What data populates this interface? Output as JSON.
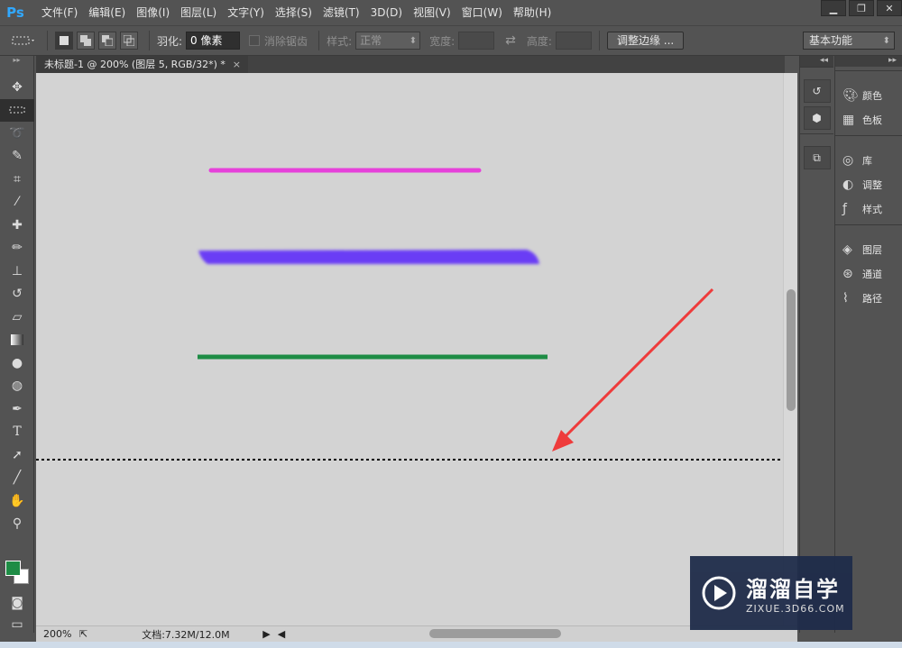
{
  "app": {
    "logo": "Ps",
    "menus": [
      "文件(F)",
      "编辑(E)",
      "图像(I)",
      "图层(L)",
      "文字(Y)",
      "选择(S)",
      "滤镜(T)",
      "3D(D)",
      "视图(V)",
      "窗口(W)",
      "帮助(H)"
    ],
    "window_controls": [
      "minimize-icon",
      "restore-icon",
      "close-icon"
    ]
  },
  "options": {
    "feather_label": "羽化:",
    "feather_value": "0 像素",
    "antialias_label": "消除锯齿",
    "style_label": "样式:",
    "style_value": "正常",
    "width_label": "宽度:",
    "height_label": "高度:",
    "refine_edge_label": "调整边缘 ...",
    "workspace": "基本功能"
  },
  "document": {
    "tab_title": "未标题-1 @ 200% (图层 5, RGB/32*) *",
    "tab_close": "×",
    "zoom": "200%",
    "doc_info": "文档:7.32M/12.0M"
  },
  "tools": [
    "move-icon",
    "marquee-icon",
    "lasso-icon",
    "quick-select-icon",
    "crop-icon",
    "eyedropper-icon",
    "healing-icon",
    "brush-icon",
    "stamp-icon",
    "history-brush-icon",
    "eraser-icon",
    "gradient-icon",
    "blur-icon",
    "dodge-icon",
    "pen-icon",
    "type-icon",
    "path-select-icon",
    "line-icon",
    "hand-icon",
    "zoom-icon"
  ],
  "colors": {
    "foreground": "#1e8c45",
    "background": "#ffffff",
    "magenta_stroke": "#e83adb",
    "purple_stroke": "#6a3cf5",
    "green_stroke": "#1e8c45",
    "arrow": "#ee3b3b"
  },
  "panels": [
    {
      "icon": "palette-icon",
      "label": "颜色"
    },
    {
      "icon": "swatches-icon",
      "label": "色板"
    },
    {
      "icon": "library-icon",
      "label": "库"
    },
    {
      "icon": "adjustments-icon",
      "label": "调整"
    },
    {
      "icon": "styles-icon",
      "label": "样式"
    },
    {
      "icon": "layers-icon",
      "label": "图层"
    },
    {
      "icon": "channels-icon",
      "label": "通道"
    },
    {
      "icon": "paths-icon",
      "label": "路径"
    }
  ],
  "watermark": {
    "title": "溜溜自学",
    "url": "ZIXUE.3D66.COM"
  }
}
